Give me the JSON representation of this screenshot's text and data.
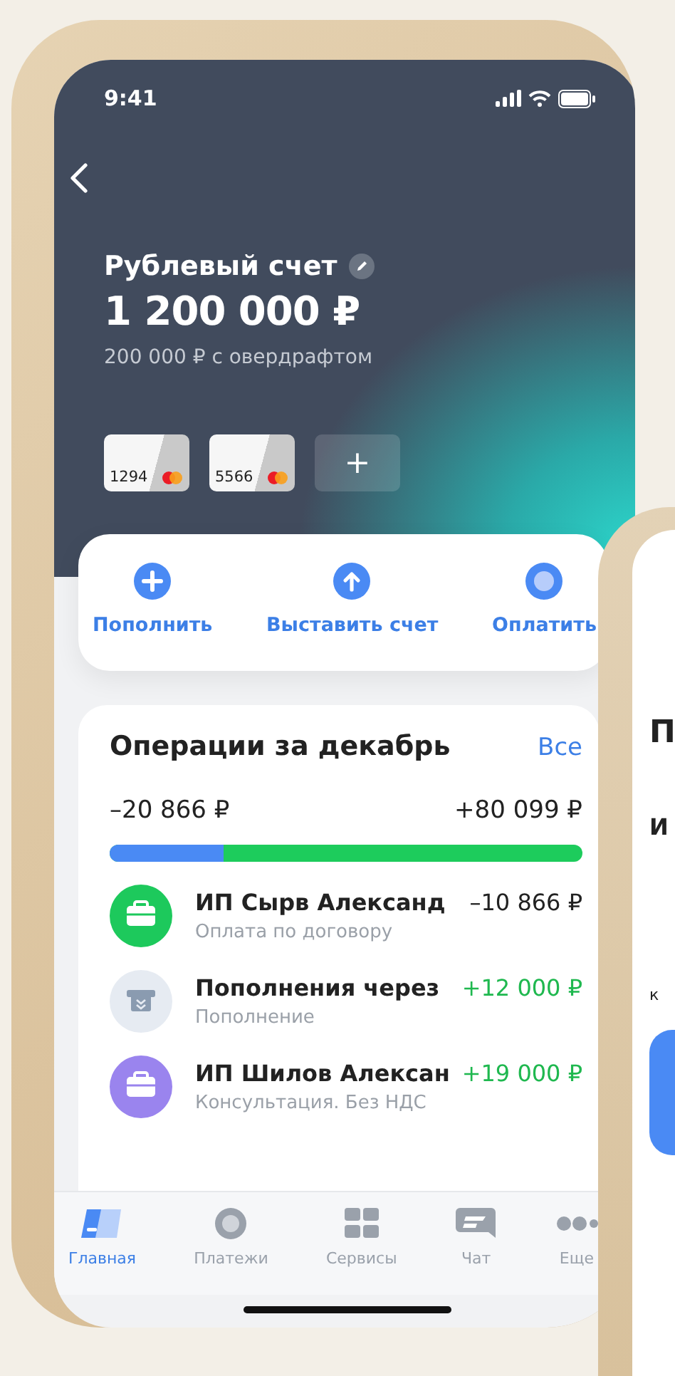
{
  "status_bar": {
    "time": "9:41"
  },
  "account": {
    "title": "Рублевый счет",
    "balance": "1 200 000 ₽",
    "overdraft": "200 000 ₽ с овердрафтом"
  },
  "cards": [
    {
      "number": "1294"
    },
    {
      "number": "5566"
    }
  ],
  "add_card": {
    "label": "+"
  },
  "actions": [
    {
      "kind": "plus",
      "label": "Пополнить"
    },
    {
      "kind": "up",
      "label": "Выставить счет"
    },
    {
      "kind": "dot",
      "label": "Оплатить"
    }
  ],
  "operations": {
    "title": "Операции за декабрь",
    "link": "Все",
    "outgoing": "–20 866 ₽",
    "incoming": "+80 099 ₽",
    "level": 0.24,
    "items": [
      {
        "kind": "briefcase",
        "color": "#1dc95c",
        "name": "ИП Сырв Александ",
        "note": "Оплата по договору",
        "amount": "–10 866 ₽",
        "positive": false
      },
      {
        "kind": "atm",
        "color": "#e6ebf2",
        "name": "Пополнения через",
        "note": "Пополнение",
        "amount": "+12 000 ₽",
        "positive": true
      },
      {
        "kind": "briefcase",
        "color": "#9a84ee",
        "name": "ИП Шилов Алексан",
        "note": "Консультация. Без НДС",
        "amount": "+19 000 ₽",
        "positive": true
      }
    ]
  },
  "tabs": [
    {
      "kind": "home",
      "label": "Главная",
      "selected": true
    },
    {
      "kind": "pay",
      "label": "Платежи",
      "selected": false
    },
    {
      "kind": "grid",
      "label": "Сервисы",
      "selected": false
    },
    {
      "kind": "chat",
      "label": "Чат",
      "selected": false
    },
    {
      "kind": "more",
      "label": "Еще",
      "selected": false
    }
  ],
  "second_phone": {
    "heading": "П",
    "subheading": "И",
    "caption": "к"
  }
}
